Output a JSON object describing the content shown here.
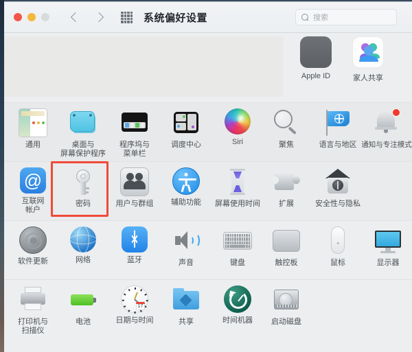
{
  "window": {
    "title": "系统偏好设置",
    "traffic_lights": [
      "close",
      "minimize",
      "zoom"
    ],
    "nav": {
      "back": "back",
      "forward": "forward",
      "grid": "show-all"
    },
    "search": {
      "placeholder": "搜索",
      "value": ""
    }
  },
  "accent": {
    "highlight": "#f04a37",
    "window_bg": "#ececec",
    "content_bg": "#eceef0"
  },
  "top_row": [
    {
      "label": "Apple ID",
      "icon": "apple-id-icon"
    },
    {
      "label": "家人共享",
      "icon": "family-sharing-icon"
    }
  ],
  "rows": [
    {
      "name": "row-system",
      "items": [
        {
          "label": "通用",
          "icon": "general-icon"
        },
        {
          "label": "桌面与\n屏幕保护程序",
          "icon": "desktop-screensaver-icon"
        },
        {
          "label": "程序坞与\n菜单栏",
          "icon": "dock-menubar-icon"
        },
        {
          "label": "调度中心",
          "icon": "mission-control-icon"
        },
        {
          "label": "Siri",
          "icon": "siri-icon"
        },
        {
          "label": "聚焦",
          "icon": "spotlight-icon"
        },
        {
          "label": "语言与地区",
          "icon": "language-region-icon"
        },
        {
          "label": "通知与专注模式",
          "icon": "notifications-focus-icon"
        }
      ]
    },
    {
      "name": "row-accounts",
      "items": [
        {
          "label": "互联网\n帐户",
          "icon": "internet-accounts-icon"
        },
        {
          "label": "密码",
          "icon": "passwords-key-icon",
          "highlighted": true
        },
        {
          "label": "用户与群组",
          "icon": "users-groups-icon"
        },
        {
          "label": "辅助功能",
          "icon": "accessibility-icon"
        },
        {
          "label": "屏幕使用时间",
          "icon": "screen-time-icon"
        },
        {
          "label": "扩展",
          "icon": "extensions-icon"
        },
        {
          "label": "安全性与隐私",
          "icon": "security-privacy-icon"
        }
      ]
    },
    {
      "name": "row-hardware",
      "items": [
        {
          "label": "软件更新",
          "icon": "software-update-icon"
        },
        {
          "label": "网络",
          "icon": "network-icon"
        },
        {
          "label": "蓝牙",
          "icon": "bluetooth-icon"
        },
        {
          "label": "声音",
          "icon": "sound-icon"
        },
        {
          "label": "键盘",
          "icon": "keyboard-icon"
        },
        {
          "label": "触控板",
          "icon": "trackpad-icon"
        },
        {
          "label": "鼠标",
          "icon": "mouse-icon"
        },
        {
          "label": "显示器",
          "icon": "displays-icon"
        }
      ]
    },
    {
      "name": "row-devices",
      "items": [
        {
          "label": "打印机与\n扫描仪",
          "icon": "printers-scanners-icon"
        },
        {
          "label": "电池",
          "icon": "battery-icon"
        },
        {
          "label": "日期与时间",
          "icon": "date-time-icon"
        },
        {
          "label": "共享",
          "icon": "sharing-icon"
        },
        {
          "label": "时间机器",
          "icon": "time-machine-icon"
        },
        {
          "label": "启动磁盘",
          "icon": "startup-disk-icon"
        }
      ]
    }
  ],
  "clock": {
    "day": "17"
  },
  "bluetooth_glyph": "ᚼ",
  "at_glyph": "@",
  "apple_glyph": ""
}
